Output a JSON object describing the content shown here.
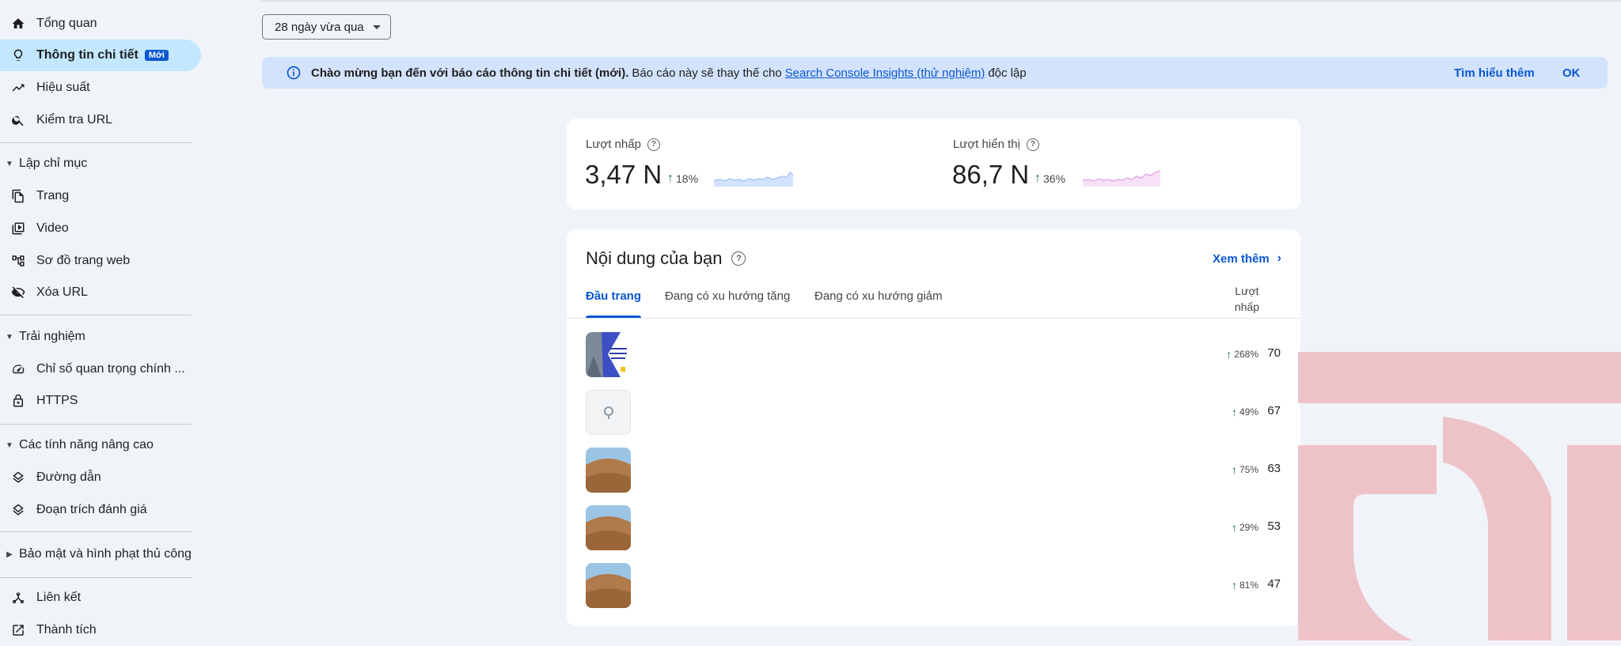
{
  "sidebar": {
    "items_top": [
      {
        "label": "Tổng quan",
        "icon": "home-icon"
      },
      {
        "label": "Thông tin chi tiết",
        "icon": "lightbulb-icon",
        "badge": "Mới",
        "active": true
      },
      {
        "label": "Hiệu suất",
        "icon": "trending-up-icon"
      },
      {
        "label": "Kiểm tra URL",
        "icon": "search-icon"
      }
    ],
    "indexing": {
      "title": "Lập chỉ mục",
      "items": [
        {
          "label": "Trang",
          "icon": "pages-icon"
        },
        {
          "label": "Video",
          "icon": "video-icon"
        },
        {
          "label": "Sơ đồ trang web",
          "icon": "sitemap-icon"
        },
        {
          "label": "Xóa URL",
          "icon": "visibility-off-icon"
        }
      ]
    },
    "experience": {
      "title": "Trải nghiệm",
      "items": [
        {
          "label": "Chỉ số quan trọng chính ...",
          "icon": "speed-icon"
        },
        {
          "label": "HTTPS",
          "icon": "lock-icon"
        }
      ]
    },
    "enhancements": {
      "title": "Các tính năng nâng cao",
      "items": [
        {
          "label": "Đường dẫn",
          "icon": "layers-icon"
        },
        {
          "label": "Đoạn trích đánh giá",
          "icon": "layers-icon"
        }
      ]
    },
    "security": {
      "title": "Bảo mật và hình phạt thủ công"
    },
    "items_bottom": [
      {
        "label": "Liên kết",
        "icon": "links-icon"
      },
      {
        "label": "Thành tích",
        "icon": "open-external-icon"
      }
    ]
  },
  "date_filter": {
    "value": "28 ngày vừa qua"
  },
  "banner": {
    "bold": "Chào mừng bạn đến với báo cáo thông tin chi tiết (mới).",
    "text1": "Báo cáo này sẽ thay thế cho",
    "link": "Search Console Insights (thử nghiệm)",
    "text2": "độc lập",
    "learn_more": "Tìm hiểu thêm",
    "ok": "OK"
  },
  "metrics": {
    "clicks": {
      "label": "Lượt nhấp",
      "value": "3,47 N",
      "change": "18%",
      "spark_color": "#a8c7fa",
      "spark_fill": "#d3e3fd"
    },
    "impressions": {
      "label": "Lượt hiển thị",
      "value": "86,7 N",
      "change": "36%",
      "spark_color": "#e6a8e8",
      "spark_fill": "#f6e1f6"
    }
  },
  "content": {
    "title": "Nội dung của bạn",
    "see_more": "Xem thêm",
    "tabs": [
      "Đầu trang",
      "Đang có xu hướng tăng",
      "Đang có xu hướng giảm"
    ],
    "col_header": [
      "Lượt",
      "nhấp"
    ],
    "rows": [
      {
        "change": "268%",
        "value": "70",
        "thumb": "banner"
      },
      {
        "change": "49%",
        "value": "67",
        "thumb": "placeholder"
      },
      {
        "change": "75%",
        "value": "63",
        "thumb": "sand"
      },
      {
        "change": "29%",
        "value": "53",
        "thumb": "sand"
      },
      {
        "change": "81%",
        "value": "47",
        "thumb": "sand"
      }
    ]
  },
  "colors": {
    "accent": "#0b57d0",
    "active_bg": "#c2e7ff",
    "positive": "#137333",
    "watermark": "#eec3c8"
  }
}
